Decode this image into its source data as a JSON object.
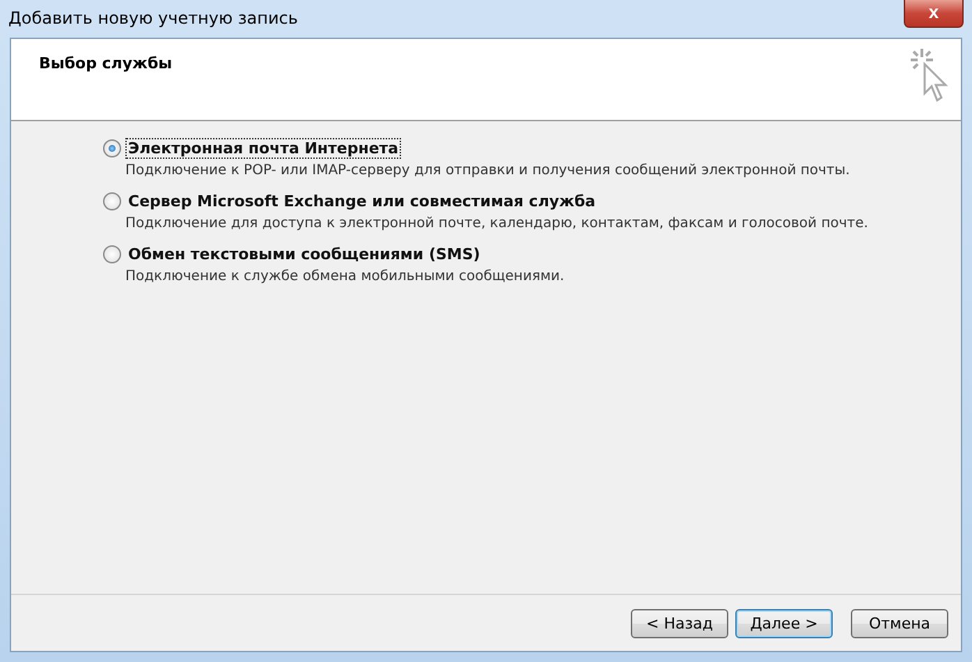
{
  "window": {
    "title": "Добавить новую учетную запись",
    "close_label": "x"
  },
  "header": {
    "title": "Выбор службы"
  },
  "options": [
    {
      "label": "Электронная почта Интернета",
      "description": "Подключение к POP- или IMAP-серверу для отправки и получения сообщений электронной почты.",
      "selected": true
    },
    {
      "label": "Сервер Microsoft Exchange или совместимая служба",
      "description": "Подключение для доступа к электронной почте, календарю, контактам, факсам и голосовой почте.",
      "selected": false
    },
    {
      "label": "Обмен текстовыми сообщениями (SMS)",
      "description": "Подключение к службе обмена мобильными сообщениями.",
      "selected": false
    }
  ],
  "buttons": [
    {
      "label": "< Назад",
      "default": false
    },
    {
      "label": "Далее >",
      "default": true
    },
    {
      "label": "Отмена",
      "default": false
    }
  ]
}
